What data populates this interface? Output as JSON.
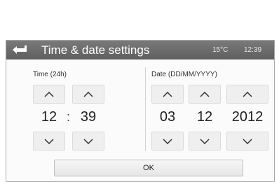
{
  "header": {
    "title": "Time & date settings",
    "temperature": "15°C",
    "time": "12:39"
  },
  "time_group": {
    "label": "Time (24h)",
    "hours": "12",
    "separator": ":",
    "minutes": "39"
  },
  "date_group": {
    "label": "Date (DD/MM/YYYY)",
    "day": "03",
    "month": "12",
    "year": "2012"
  },
  "footer": {
    "ok_label": "OK"
  },
  "icons": {
    "back": "back-arrow-icon",
    "up": "chevron-up-icon",
    "down": "chevron-down-icon"
  }
}
